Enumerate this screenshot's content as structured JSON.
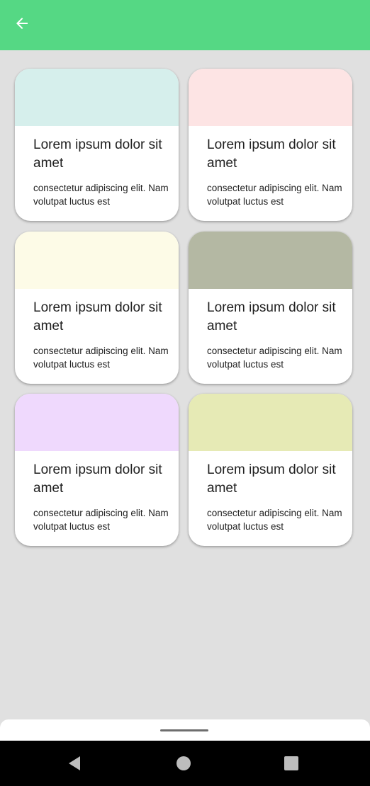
{
  "colors": {
    "app_bar": "#55d884",
    "background": "#e0e0e0",
    "card_background": "#ffffff",
    "nav_bar": "#000000",
    "nav_icon": "#bdbdbd"
  },
  "app_bar": {
    "back_icon": "arrow-back-icon"
  },
  "cards": [
    {
      "title": "Lorem ipsum dolor sit amet",
      "description": "consectetur adipiscing elit. Nam volutpat luctus est",
      "swatch_color": "#d6efec"
    },
    {
      "title": "Lorem ipsum dolor sit amet",
      "description": "consectetur adipiscing elit. Nam volutpat luctus est",
      "swatch_color": "#fde4e4"
    },
    {
      "title": "Lorem ipsum dolor sit amet",
      "description": "consectetur adipiscing elit. Nam volutpat luctus est",
      "swatch_color": "#fdfbe7"
    },
    {
      "title": "Lorem ipsum dolor sit amet",
      "description": "consectetur adipiscing elit. Nam volutpat luctus est",
      "swatch_color": "#b4b8a3"
    },
    {
      "title": "Lorem ipsum dolor sit amet",
      "description": "consectetur adipiscing elit. Nam volutpat luctus est",
      "swatch_color": "#efd9fd"
    },
    {
      "title": "Lorem ipsum dolor sit amet",
      "description": "consectetur adipiscing elit. Nam volutpat luctus est",
      "swatch_color": "#e6eab5"
    }
  ],
  "system_nav": {
    "back_icon": "nav-back-icon",
    "home_icon": "nav-home-icon",
    "recents_icon": "nav-recents-icon"
  }
}
